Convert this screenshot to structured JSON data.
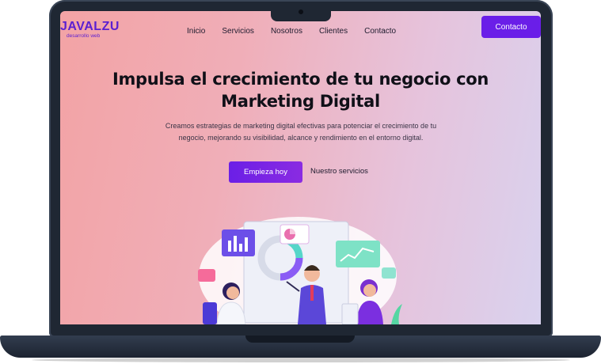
{
  "brand": {
    "name": "JAVALZU",
    "tagline": "desarrollo web"
  },
  "nav": {
    "items": [
      "Inicio",
      "Servicios",
      "Nosotros",
      "Clientes",
      "Contacto"
    ]
  },
  "header": {
    "contact_button": "Contacto"
  },
  "hero": {
    "title_line1": "Impulsa el crecimiento de tu negocio con",
    "title_line2": "Marketing Digital",
    "description_line1": "Creamos estrategias de marketing digital efectivas para potenciar el crecimiento de tu",
    "description_line2": "negocio, mejorando su visibilidad, alcance y rendimiento en el entorno digital.",
    "primary_cta": "Empieza hoy",
    "secondary_cta": "Nuestro servicios"
  },
  "colors": {
    "accent": "#6a1ee8",
    "brand": "#5b1fd1",
    "device": "#1f2733"
  }
}
